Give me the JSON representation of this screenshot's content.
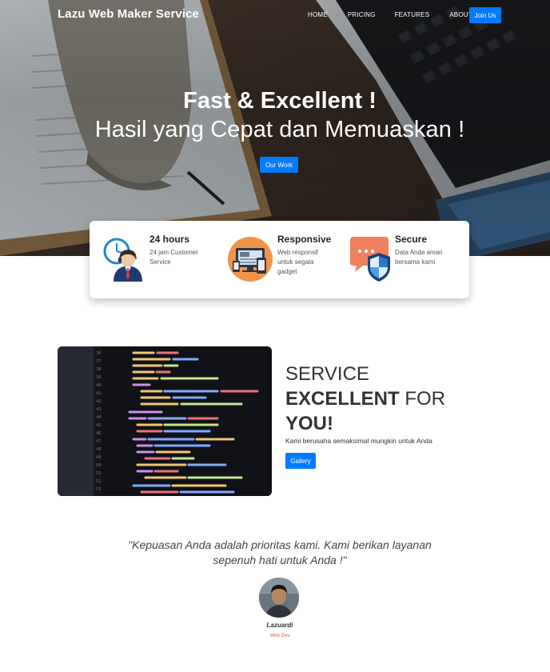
{
  "navbar": {
    "brand": "Lazu Web Maker Service",
    "links": [
      "HOME",
      "PRICING",
      "FEATURES",
      "ABOUT"
    ],
    "join_label": "Join Us"
  },
  "hero": {
    "title": "Fast & Excellent !",
    "subtitle": "Hasil yang Cepat dan Memuaskan !",
    "button_label": "Our Work"
  },
  "features": [
    {
      "title": "24 hours",
      "desc": "24 jam Customer Service",
      "icon": "customer-service-icon"
    },
    {
      "title": "Responsive",
      "desc": "Web responsif untuk segala gadget",
      "icon": "devices-icon"
    },
    {
      "title": "Secure",
      "desc": "Data Anda aman bersama kami",
      "icon": "shield-icon"
    }
  ],
  "service": {
    "heading_line1": "SERVICE",
    "heading_bold2": "EXCELLENT",
    "heading_line2_rest": " FOR",
    "heading_bold3": "YOU!",
    "text": "Kami berusaha semaksimal mungkin untuk Anda",
    "button_label": "Gallery"
  },
  "testimonial": {
    "quote": "\"Kepuasan Anda adalah prioritas kami. Kami berikan layanan sepenuh hati untuk Anda !\"",
    "name": "Lazuardi",
    "role": "Web Dev"
  },
  "colors": {
    "accent": "#007bff",
    "role_text": "#e05555"
  }
}
